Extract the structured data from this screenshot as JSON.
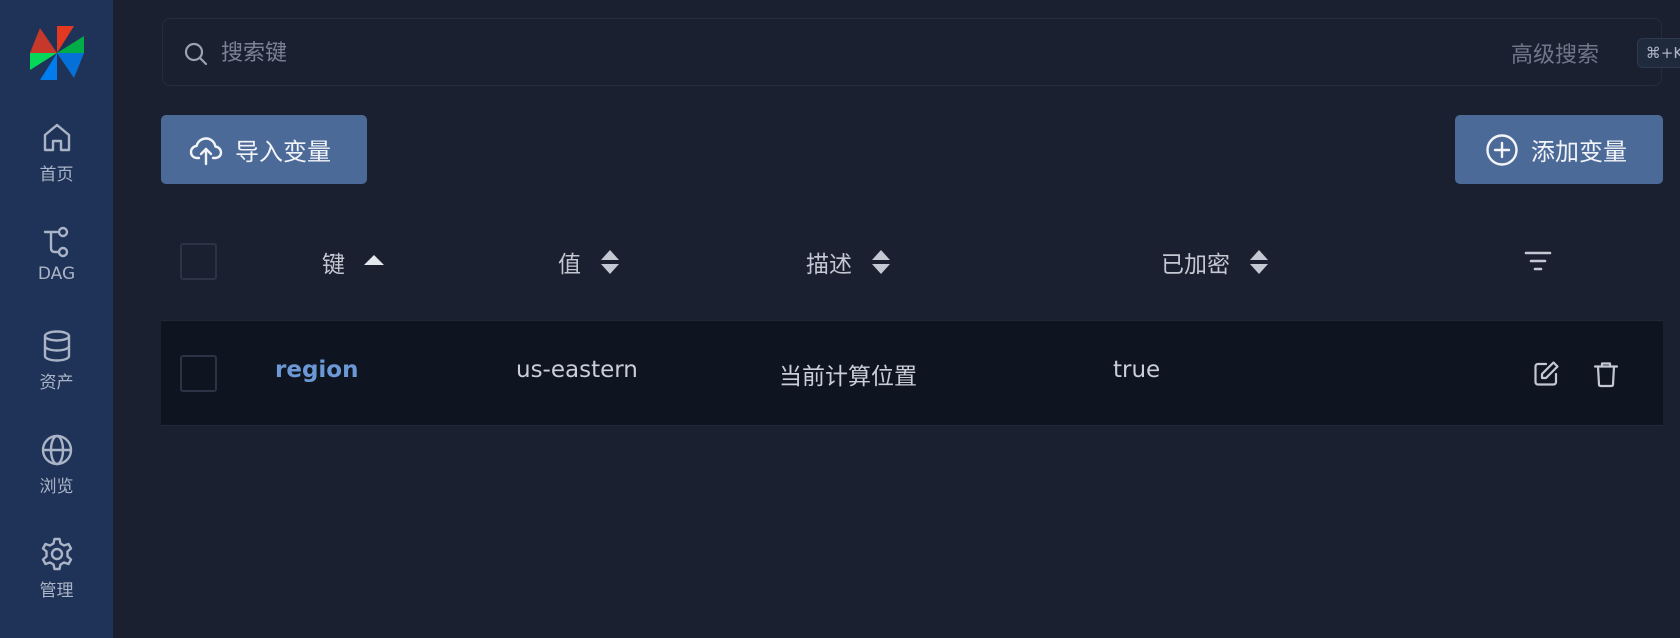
{
  "sidebar": {
    "logo": "airflow-pinwheel-logo",
    "items": [
      {
        "label": "首页",
        "icon": "home-icon"
      },
      {
        "label": "DAG",
        "icon": "dag-icon"
      },
      {
        "label": "资产",
        "icon": "database-icon"
      },
      {
        "label": "浏览",
        "icon": "globe-icon"
      },
      {
        "label": "管理",
        "icon": "gear-icon"
      }
    ]
  },
  "search": {
    "placeholder": "搜索键",
    "advanced_label": "高级搜索",
    "shortcut": "⌘+K"
  },
  "toolbar": {
    "import_label": "导入变量",
    "add_label": "添加变量"
  },
  "table": {
    "columns": [
      {
        "label": "键",
        "sort": "ascending"
      },
      {
        "label": "值",
        "sort": "none"
      },
      {
        "label": "描述",
        "sort": "none"
      },
      {
        "label": "已加密",
        "sort": "none"
      }
    ],
    "rows": [
      {
        "key": "region",
        "value": "us-eastern",
        "description": "当前计算位置",
        "encrypted": "true"
      }
    ]
  },
  "colors": {
    "sidebar_bg": "#1f3358",
    "page_bg": "#1a2030",
    "button_bg": "#4c6a98",
    "link": "#6c98d6",
    "row_bg": "#0e1521"
  }
}
